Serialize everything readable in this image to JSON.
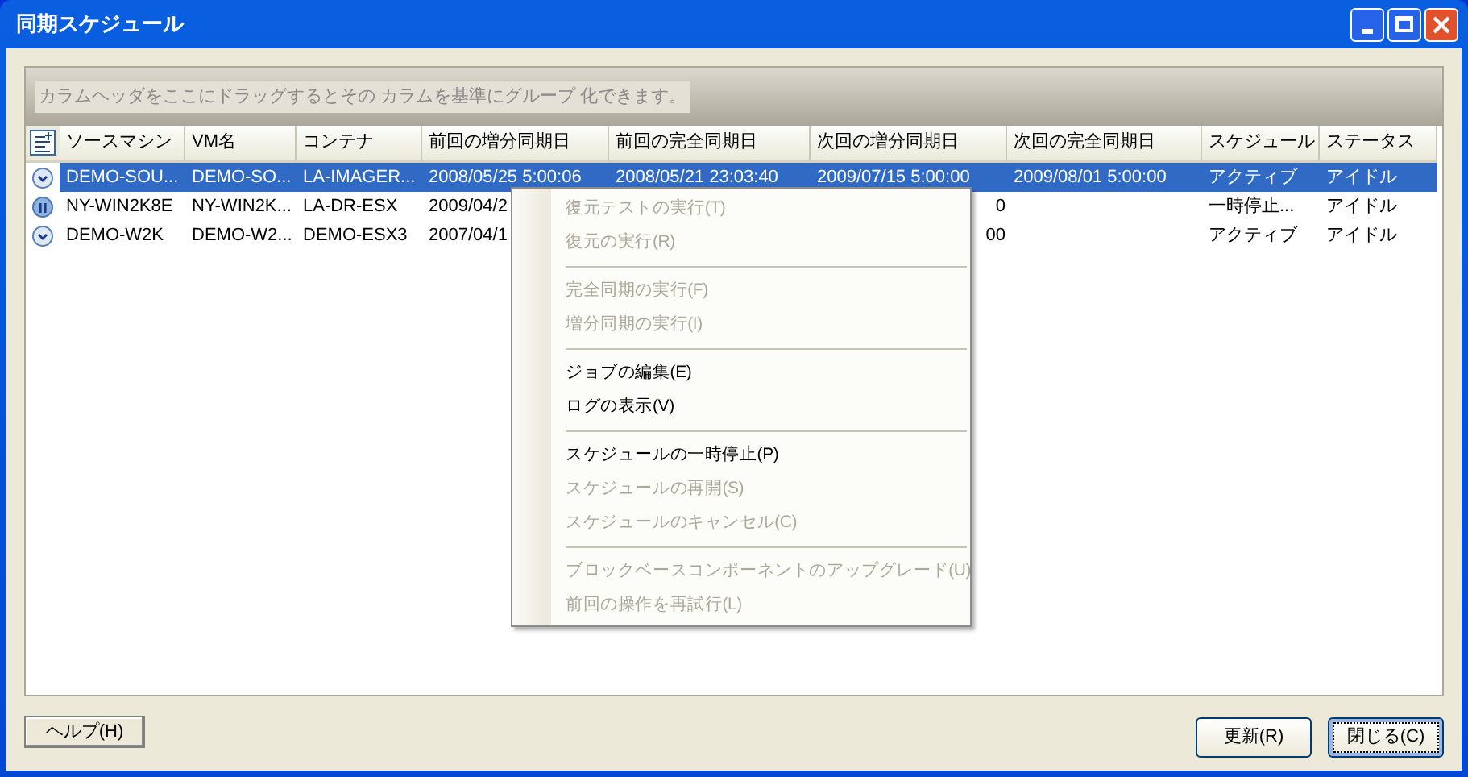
{
  "window": {
    "title": "同期スケジュール"
  },
  "group_hint": "カラムヘッダをここにドラッグするとその カラムを基準にグループ 化できます。",
  "table": {
    "columns": [
      "ソースマシン",
      "VM名",
      "コンテナ",
      "前回の増分同期日",
      "前回の完全同期日",
      "次回の増分同期日",
      "次回の完全同期日",
      "スケジュール",
      "ステータス"
    ],
    "rows": [
      {
        "selected": true,
        "kind": "active",
        "cells": [
          {
            "text": "DEMO-SOU..."
          },
          {
            "text": "DEMO-SO..."
          },
          {
            "text": "LA-IMAGER..."
          },
          {
            "text": "2008/05/25 5:00:06"
          },
          {
            "text": "2008/05/21 23:03:40"
          },
          {
            "text": "2009/07/15 5:00:00"
          },
          {
            "text": "2009/08/01 5:00:00"
          },
          {
            "text": "アクティブ"
          },
          {
            "text": "アイドル"
          }
        ]
      },
      {
        "selected": false,
        "kind": "paused",
        "cells": [
          {
            "text": "NY-WIN2K8E"
          },
          {
            "text": "NY-WIN2K..."
          },
          {
            "text": "LA-DR-ESX"
          },
          {
            "text": "2009/04/2"
          },
          {},
          {
            "text": "0",
            "kind": "clipped"
          },
          {},
          {
            "text": "一時停止..."
          },
          {
            "text": "アイドル"
          }
        ]
      },
      {
        "selected": false,
        "kind": "active",
        "cells": [
          {
            "text": "DEMO-W2K"
          },
          {
            "text": "DEMO-W2..."
          },
          {
            "text": "DEMO-ESX3"
          },
          {
            "text": "2007/04/1"
          },
          {},
          {
            "text": "00",
            "kind": "clipped"
          },
          {},
          {
            "text": "アクティブ"
          },
          {
            "text": "アイドル"
          }
        ]
      }
    ]
  },
  "context_menu": [
    {
      "kind": "item",
      "label": "復元テストの実行(T)",
      "disabled": true
    },
    {
      "kind": "item",
      "label": "復元の実行(R)",
      "disabled": true
    },
    {
      "kind": "separator"
    },
    {
      "kind": "item",
      "label": "完全同期の実行(F)",
      "disabled": true
    },
    {
      "kind": "item",
      "label": "増分同期の実行(I)",
      "disabled": true
    },
    {
      "kind": "separator"
    },
    {
      "kind": "item",
      "label": "ジョブの編集(E)",
      "disabled": false
    },
    {
      "kind": "item",
      "label": "ログの表示(V)",
      "disabled": false
    },
    {
      "kind": "separator"
    },
    {
      "kind": "item",
      "label": "スケジュールの一時停止(P)",
      "disabled": false
    },
    {
      "kind": "item",
      "label": "スケジュールの再開(S)",
      "disabled": true
    },
    {
      "kind": "item",
      "label": "スケジュールのキャンセル(C)",
      "disabled": true
    },
    {
      "kind": "separator"
    },
    {
      "kind": "item",
      "label": "ブロックベースコンポーネントのアップグレード(U)",
      "disabled": true
    },
    {
      "kind": "item",
      "label": "前回の操作を再試行(L)",
      "disabled": true
    }
  ],
  "buttons": [
    {
      "label": "ヘルプ(H)",
      "kind": "help"
    },
    {
      "label": "更新(R)",
      "kind": "normal"
    },
    {
      "label": "閉じる(C)",
      "kind": "default"
    }
  ]
}
